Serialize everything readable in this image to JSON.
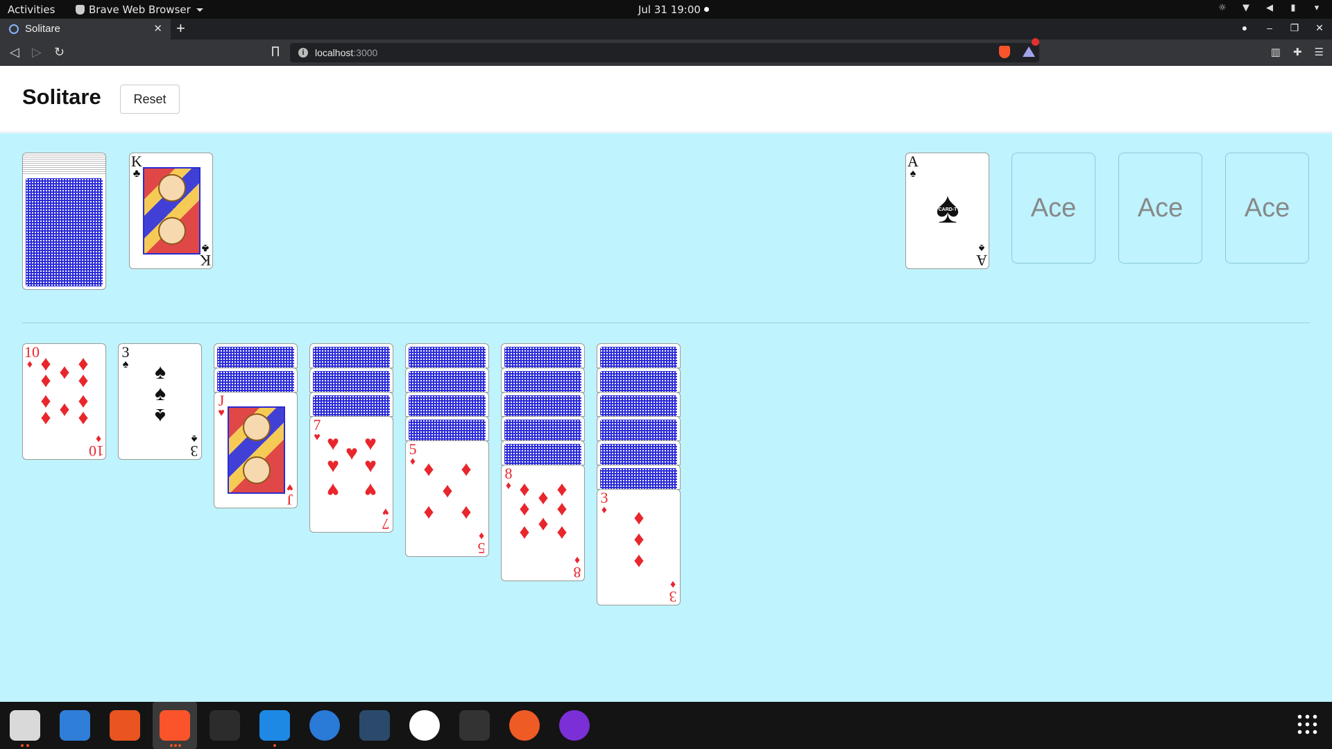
{
  "system_bar": {
    "activities": "Activities",
    "app_name": "Brave Web Browser",
    "clock": "Jul 31  19:00"
  },
  "browser": {
    "tab_title": "Solitare",
    "url_host": "localhost",
    "url_port": ":3000"
  },
  "page": {
    "title": "Solitare",
    "reset_label": "Reset"
  },
  "stock": {
    "face_down_remaining": "yes"
  },
  "waste": {
    "rank": "K",
    "suit": "♣",
    "suit_name": "clubs",
    "color": "black"
  },
  "foundations": [
    {
      "rank": "A",
      "suit": "♠",
      "suit_name": "spades",
      "logo": "CARD-T"
    },
    {
      "placeholder": "Ace"
    },
    {
      "placeholder": "Ace"
    },
    {
      "placeholder": "Ace"
    }
  ],
  "tableau": [
    {
      "face_down": 0,
      "top": {
        "rank": "10",
        "suit": "♦",
        "color": "red"
      }
    },
    {
      "face_down": 0,
      "top": {
        "rank": "3",
        "suit": "♠",
        "color": "black"
      }
    },
    {
      "face_down": 2,
      "top": {
        "rank": "J",
        "suit": "♥",
        "color": "red"
      }
    },
    {
      "face_down": 3,
      "top": {
        "rank": "7",
        "suit": "♥",
        "color": "red"
      }
    },
    {
      "face_down": 4,
      "top": {
        "rank": "5",
        "suit": "♦",
        "color": "red"
      }
    },
    {
      "face_down": 5,
      "top": {
        "rank": "8",
        "suit": "♦",
        "color": "red"
      }
    },
    {
      "face_down": 6,
      "top": {
        "rank": "3",
        "suit": "♦",
        "color": "red"
      }
    }
  ],
  "dock": {
    "apps": [
      "files",
      "text-editor",
      "app-center",
      "brave",
      "figma",
      "vscode",
      "help",
      "mysql-workbench",
      "mongodb-compass",
      "terminal",
      "postman",
      "firefox"
    ]
  }
}
